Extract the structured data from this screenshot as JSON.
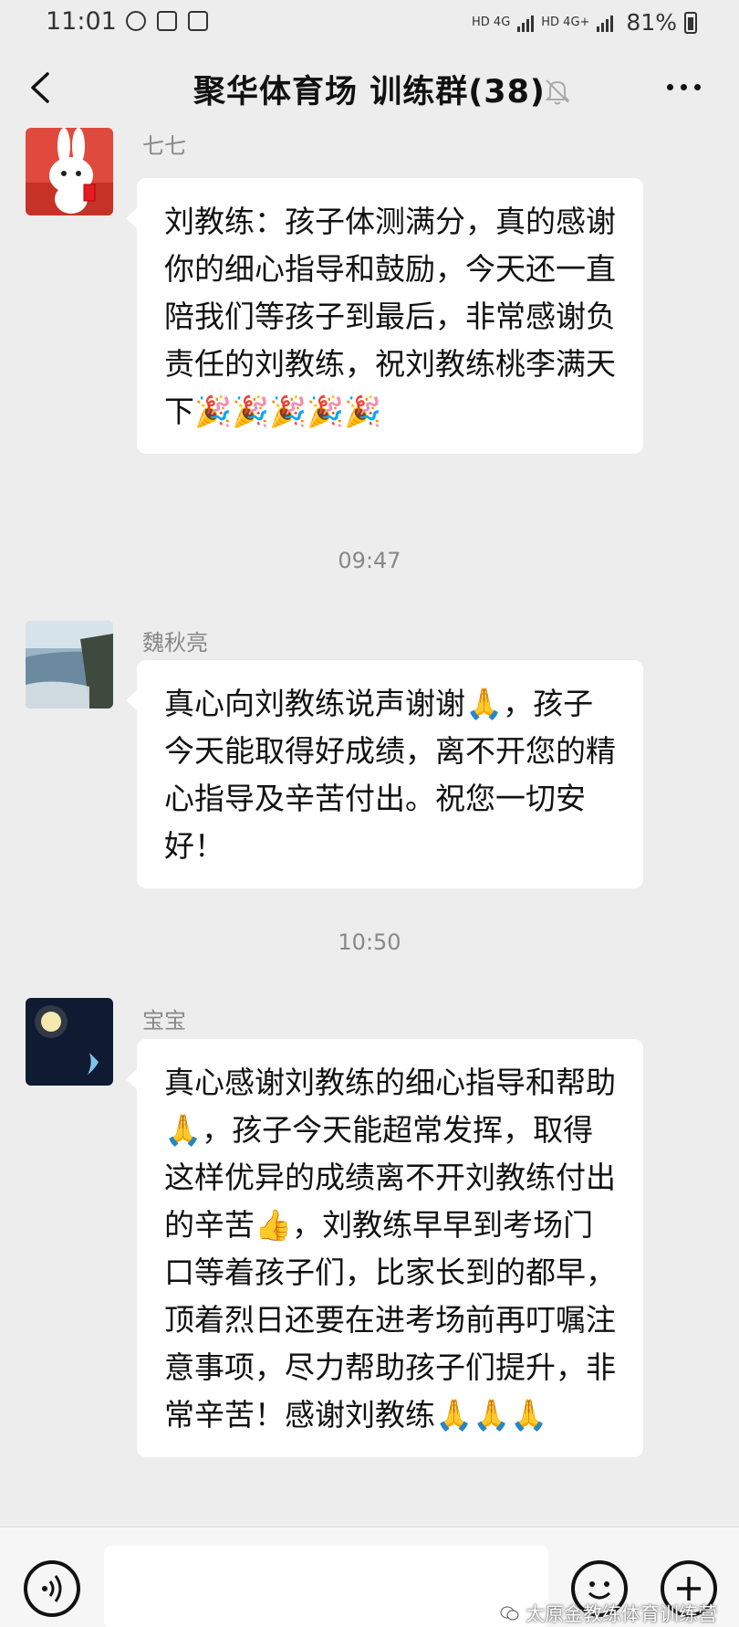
{
  "status_bar": {
    "time": "11:01",
    "network_1": "HD 4G",
    "network_2": "HD 4G+",
    "battery": "81%"
  },
  "header": {
    "title": "聚华体育场  训练群(38)",
    "back_icon": "back-arrow-icon",
    "mute_icon": "bell-muted-icon",
    "more_icon": "more-dots-icon"
  },
  "messages": [
    {
      "sender": "七七",
      "avatar": "rabbit-avatar",
      "text": "刘教练：孩子体测满分，真的感谢你的细心指导和鼓励，今天还一直陪我们等孩子到最后，非常感谢负责任的刘教练，祝刘教练桃李满天下🎉🎉🎉🎉🎉"
    },
    {
      "timestamp": "09:47",
      "sender": "魏秋亮",
      "avatar": "coast-avatar",
      "text": "真心向刘教练说声谢谢🙏，孩子今天能取得好成绩，离不开您的精心指导及辛苦付出。祝您一切安好！"
    },
    {
      "timestamp": "10:50",
      "sender": "宝宝",
      "avatar": "night-moon-avatar",
      "text": "真心感谢刘教练的细心指导和帮助🙏，孩子今天能超常发挥，取得这样优异的成绩离不开刘教练付出的辛苦👍，刘教练早早到考场门口等着孩子们，比家长到的都早，顶着烈日还要在进考场前再叮嘱注意事项，尽力帮助孩子们提升，非常辛苦！感谢刘教练🙏🙏🙏"
    }
  ],
  "input_bar": {
    "voice_icon": "voice-icon",
    "emoji_icon": "emoji-icon",
    "plus_icon": "plus-icon"
  },
  "watermark": "太原金教练体育训练营"
}
